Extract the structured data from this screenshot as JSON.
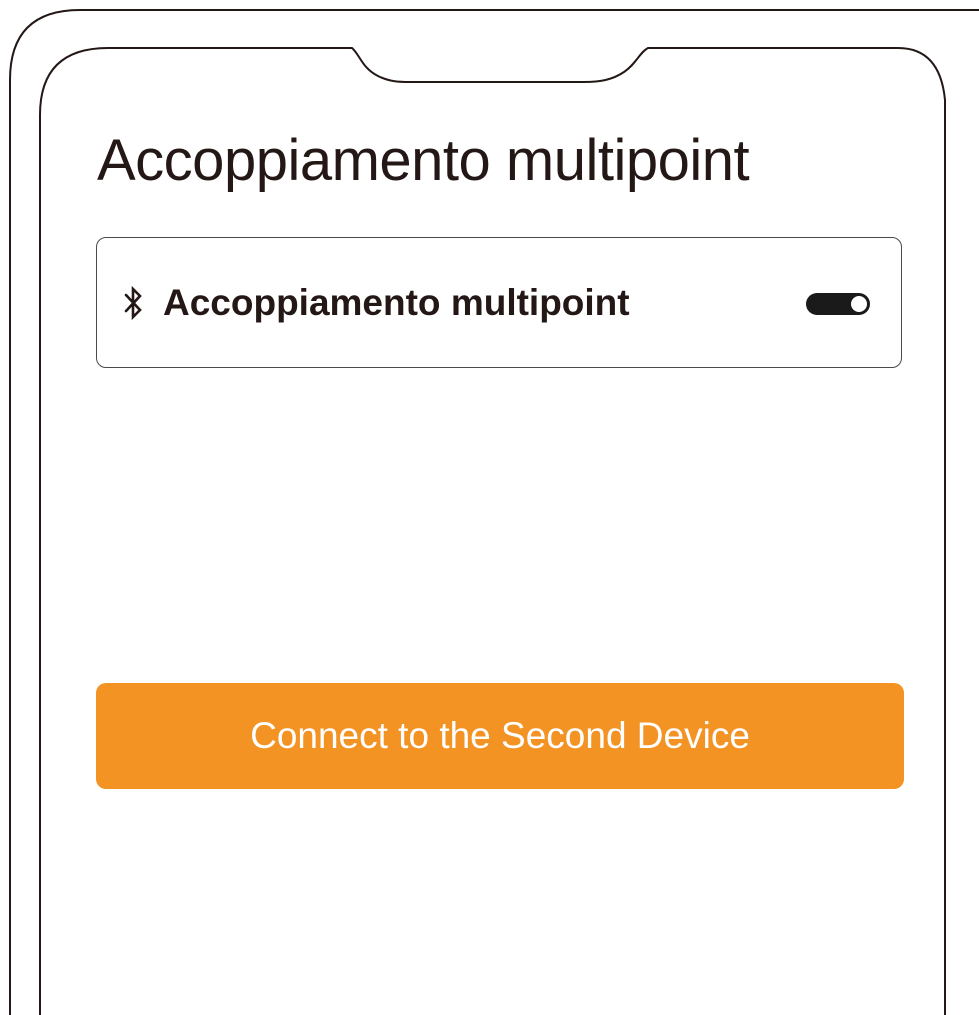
{
  "header": {
    "title": "Accoppiamento multipoint"
  },
  "settings": {
    "multipoint": {
      "icon": "bluetooth-icon",
      "label": "Accoppiamento multipoint",
      "enabled": true
    }
  },
  "actions": {
    "connect_label": "Connect to the Second Device"
  },
  "colors": {
    "accent": "#f39323",
    "text": "#231815",
    "toggle_on": "#1a1a1a",
    "frame": "#231815"
  }
}
